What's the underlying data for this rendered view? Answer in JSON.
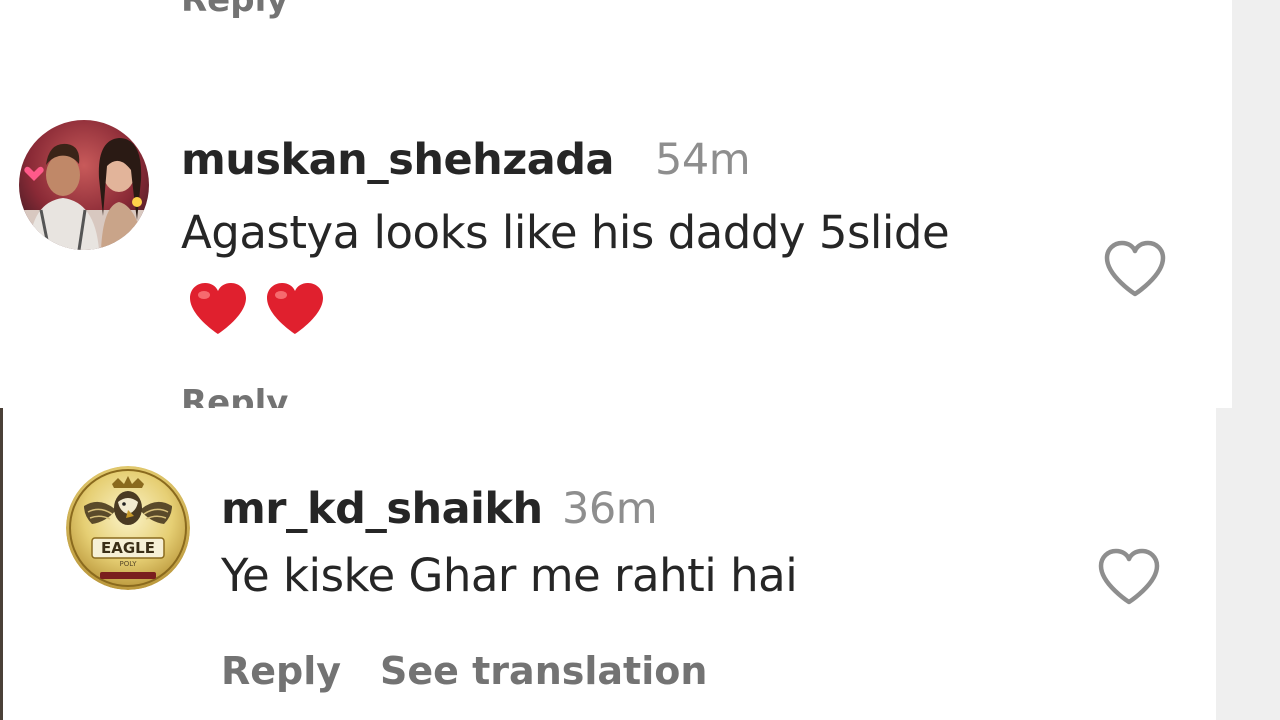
{
  "comments": [
    {
      "username": "",
      "reply_label": "Reply"
    },
    {
      "username": "muskan_shehzada",
      "time": "54m",
      "text": "Agastya looks like his daddy 5slide",
      "emoji": [
        "red-heart",
        "red-heart"
      ],
      "reply_label": "Reply",
      "avatar_icon": "couple-photo-avatar"
    },
    {
      "username": "mr_kd_shaikh",
      "time": "36m",
      "text": "Ye kiske Ghar me rahti hai",
      "reply_label": "Reply",
      "translation_label": "See translation",
      "avatar_icon": "eagle-logo-avatar",
      "avatar_text": "EAGLE"
    }
  ],
  "colors": {
    "username": "#262626",
    "secondary": "#8e8e8e",
    "action": "#737373",
    "heart_emoji": "#e0202e",
    "background_side": "#efefef"
  }
}
